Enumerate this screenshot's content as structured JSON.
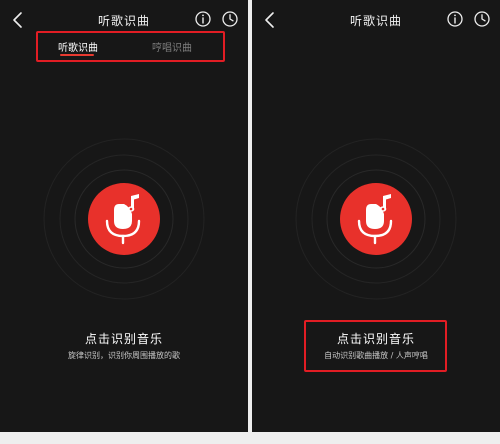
{
  "screens": [
    {
      "header": {
        "title": "听歌识曲",
        "back_icon": "chevron-left-icon",
        "info_icon": "info-circle-icon",
        "history_icon": "clock-icon"
      },
      "tabs": [
        {
          "label": "听歌识曲",
          "active": true
        },
        {
          "label": "哼唱识曲",
          "active": false
        }
      ],
      "mic_icon": "microphone-note-icon",
      "action_label": "点击识别音乐",
      "hint": "旋律识别，识别你周围播放的歌"
    },
    {
      "header": {
        "title": "听歌识曲",
        "back_icon": "chevron-left-icon",
        "info_icon": "info-circle-icon",
        "history_icon": "clock-icon"
      },
      "mic_icon": "microphone-note-icon",
      "action_label": "点击识别音乐",
      "hint": "自动识别歌曲播放 / 人声哼唱"
    }
  ],
  "colors": {
    "background": "#171717",
    "accent": "#e8312b",
    "annotation": "#e21d24"
  }
}
